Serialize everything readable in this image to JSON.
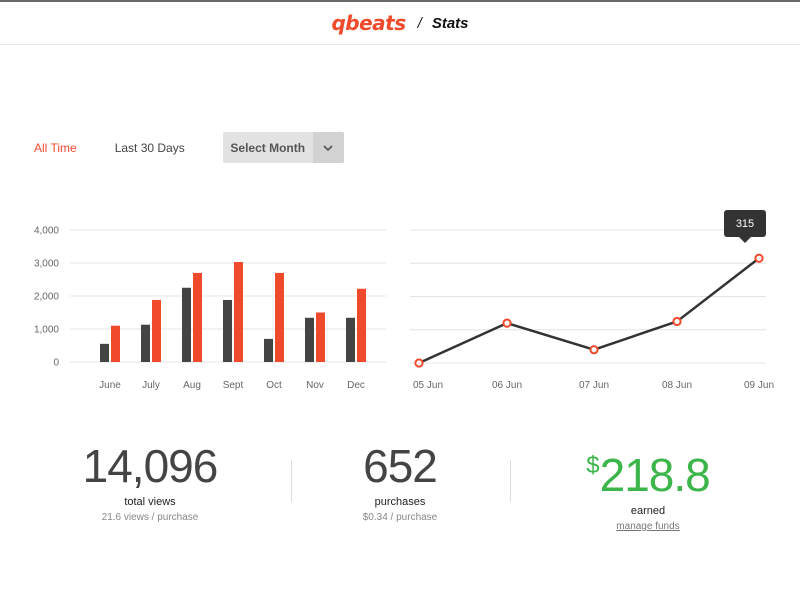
{
  "header": {
    "brand": "qbeats",
    "separator": "/",
    "title": "Stats"
  },
  "filters": {
    "all_time": "All Time",
    "last_30_days": "Last 30 Days",
    "select_month": "Select Month",
    "active": "All Time"
  },
  "colors": {
    "accent": "#f04a2c",
    "dark_bar": "#444444",
    "line": "#333333",
    "green": "#3cb54a"
  },
  "icons": {
    "dropdown": "chevron-down-icon"
  },
  "chart_data": [
    {
      "type": "bar",
      "categories": [
        "June",
        "July",
        "Aug",
        "Sept",
        "Oct",
        "Nov",
        "Dec"
      ],
      "series": [
        {
          "values": [
            550,
            1130,
            2250,
            1880,
            700,
            1340,
            1340
          ],
          "color": "#444444"
        },
        {
          "values": [
            1100,
            1880,
            2700,
            3030,
            2700,
            1500,
            2220
          ],
          "color": "#f04a2c"
        }
      ],
      "yticks": [
        "0",
        "1,000",
        "2,000",
        "3,000",
        "4,000"
      ],
      "ylim": [
        0,
        4000
      ],
      "grid": true
    },
    {
      "type": "line",
      "x": [
        "05 Jun",
        "06 Jun",
        "07 Jun",
        "08 Jun",
        "09 Jun"
      ],
      "values": [
        0,
        120,
        40,
        125,
        315
      ],
      "ylim": [
        0,
        400
      ],
      "grid": true,
      "tooltip": {
        "label": "315",
        "index": 4
      }
    }
  ],
  "stats": [
    {
      "value": "14,096",
      "label": "total views",
      "sub": "21.6 views / purchase"
    },
    {
      "value": "652",
      "label": "purchases",
      "sub": "$0.34 / purchase"
    },
    {
      "currency": "$",
      "value": "218.8",
      "label": "earned",
      "sub": "manage funds"
    }
  ]
}
